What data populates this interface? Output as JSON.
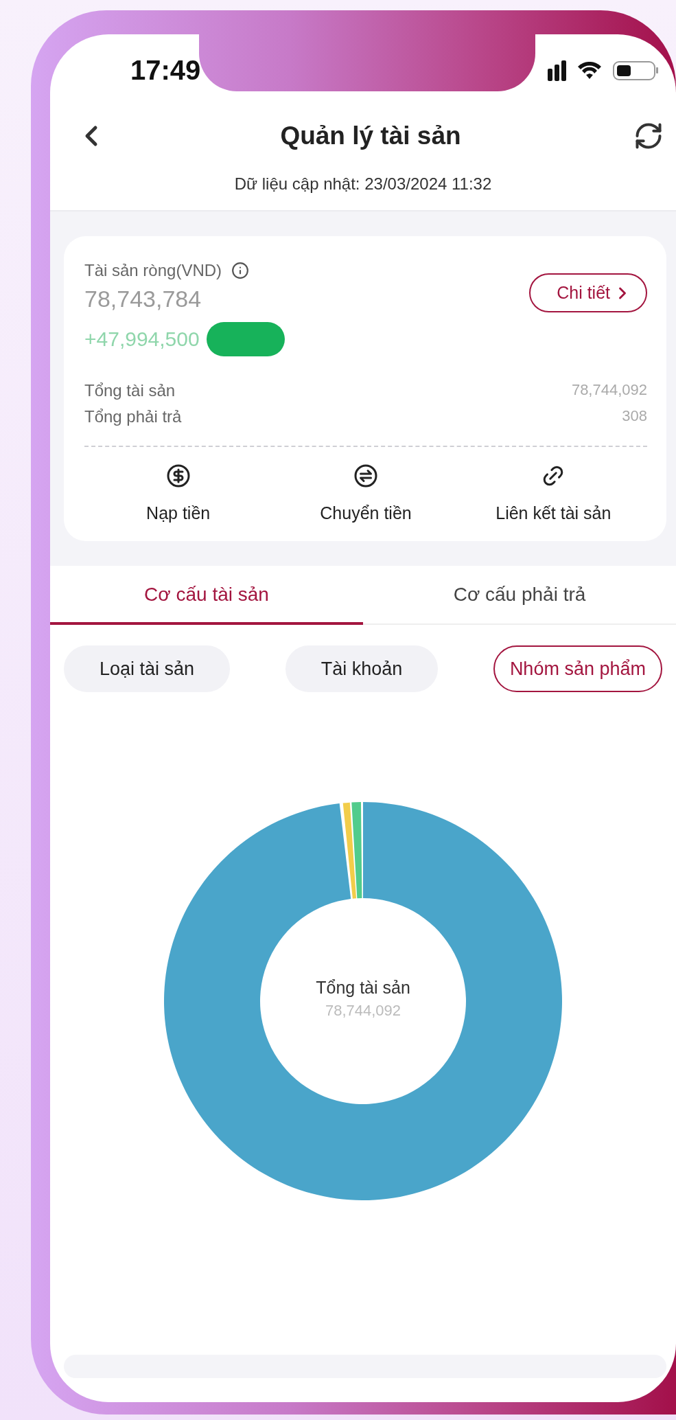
{
  "status_bar": {
    "time": "17:49"
  },
  "header": {
    "title": "Quản lý tài sản",
    "updated": "Dữ liệu cập nhật: 23/03/2024 11:32"
  },
  "summary": {
    "label": "Tài sản ròng(VND)",
    "net_value": "78,743,784",
    "change": "+47,994,500",
    "detail_button": "Chi tiết",
    "rows": [
      {
        "label": "Tổng tài sản",
        "value": "78,744,092"
      },
      {
        "label": "Tổng phải trả",
        "value": "308"
      }
    ]
  },
  "actions": [
    {
      "kind": "deposit",
      "label": "Nạp tiền"
    },
    {
      "kind": "transfer",
      "label": "Chuyển tiền"
    },
    {
      "kind": "link",
      "label": "Liên kết tài sản"
    }
  ],
  "tabs": [
    {
      "label": "Cơ cấu tài sản",
      "selected": true
    },
    {
      "label": "Cơ cấu phải trả",
      "selected": false
    }
  ],
  "filters": [
    {
      "label": "Loại tài sản",
      "selected": false
    },
    {
      "label": "Tài khoản",
      "selected": false
    },
    {
      "label": "Nhóm sản phẩm",
      "selected": true
    }
  ],
  "donut": {
    "center_label": "Tổng tài sản",
    "center_value": "78,744,092"
  }
}
